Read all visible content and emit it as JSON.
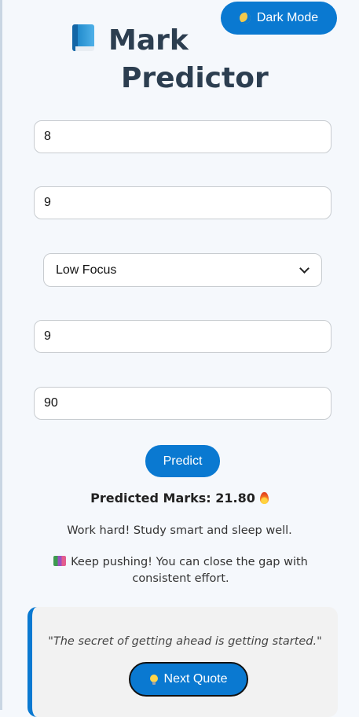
{
  "header": {
    "title_line1": "Mark",
    "title_line2": "Predictor",
    "title_icon": "book-icon",
    "dark_mode_label": "Dark Mode",
    "dark_mode_icon": "moon-icon"
  },
  "form": {
    "field1_value": "8",
    "field2_value": "9",
    "focus_select_value": "Low Focus",
    "field3_value": "9",
    "field4_value": "90",
    "predict_label": "Predict"
  },
  "result": {
    "label": "Predicted Marks: 21.80",
    "icon": "fire-icon",
    "advice": "Work hard! Study smart and sleep well.",
    "tip": "Keep pushing! You can close the gap with consistent effort.",
    "tip_icon": "books-icon"
  },
  "quote": {
    "text": "\"The secret of getting ahead is getting started.\"",
    "next_label": "Next Quote",
    "next_icon": "lightbulb-icon"
  },
  "colors": {
    "accent": "#0a79d1",
    "background": "#f5f8fc",
    "title": "#2c3e50"
  }
}
